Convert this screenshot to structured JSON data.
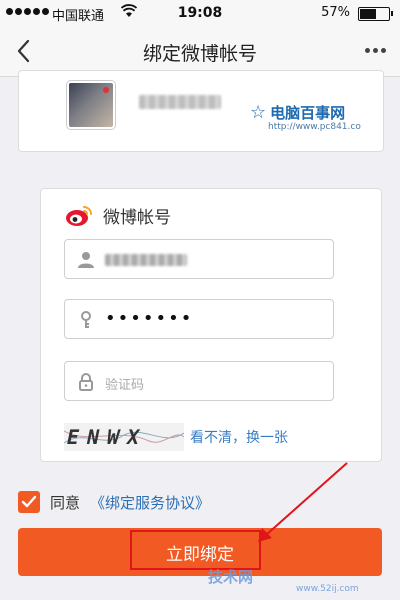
{
  "status_bar": {
    "carrier": "中国联通",
    "time": "19:08",
    "battery_percent": "57%",
    "battery_level": 0.57,
    "signal_bars": 5
  },
  "nav": {
    "title": "绑定微博帐号",
    "back_icon": "chevron-left-icon",
    "more_icon": "more-dots-icon"
  },
  "profile": {
    "avatar_icon": "avatar-image"
  },
  "watermark": {
    "site_name": "电脑百事网",
    "site_url": "http://www.pc841.co",
    "bottom_name": "技术网",
    "bottom_url": "www.52ij.com"
  },
  "form": {
    "header_label": "微博帐号",
    "password_value": "•••••••",
    "captcha_placeholder": "验证码",
    "captcha_text": "ENWX",
    "refresh_link": "看不清，换一张"
  },
  "agreement": {
    "prefix": "同意",
    "link": "《绑定服务协议》",
    "checked": true
  },
  "submit": {
    "label": "立即绑定"
  },
  "colors": {
    "accent": "#f15a22",
    "link": "#3a7cc2",
    "highlight": "#e0141a"
  }
}
